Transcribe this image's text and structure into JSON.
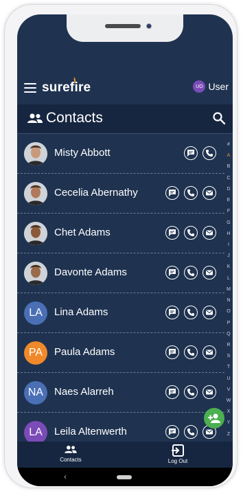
{
  "app": {
    "logo_text": "surefire",
    "user_initials": "UO",
    "user_label": "User",
    "colors": {
      "background": "#1f3350",
      "header": "#162640",
      "fab": "#4caf50",
      "user_avatar": "#7b4bb7"
    }
  },
  "header": {
    "title": "Contacts",
    "icon": "contacts-icon",
    "search_icon": "search-icon"
  },
  "contacts": [
    {
      "name": "Misty Abbott",
      "initials": "",
      "photo": true,
      "actions": [
        "message",
        "call"
      ]
    },
    {
      "name": "Cecelia Abernathy",
      "initials": "",
      "photo": true,
      "actions": [
        "message",
        "call",
        "email"
      ]
    },
    {
      "name": "Chet Adams",
      "initials": "",
      "photo": true,
      "actions": [
        "message",
        "call",
        "email"
      ]
    },
    {
      "name": "Davonte Adams",
      "initials": "",
      "photo": true,
      "actions": [
        "message",
        "call",
        "email"
      ]
    },
    {
      "name": "Lina Adams",
      "initials": "LA",
      "photo": false,
      "color": "#4a6fb5",
      "actions": [
        "message",
        "call",
        "email"
      ]
    },
    {
      "name": "Paula Adams",
      "initials": "PA",
      "photo": false,
      "color": "#f0892a",
      "actions": [
        "message",
        "call",
        "email"
      ]
    },
    {
      "name": "Naes Alarreh",
      "initials": "NA",
      "photo": false,
      "color": "#4a6fb5",
      "actions": [
        "message",
        "call",
        "email"
      ]
    },
    {
      "name": "Leila Altenwerth",
      "initials": "LA",
      "photo": false,
      "color": "#7b4bb7",
      "actions": [
        "message",
        "call",
        "email"
      ]
    }
  ],
  "alphabet": [
    "#",
    "A",
    "B",
    "C",
    "D",
    "E",
    "F",
    "G",
    "H",
    "I",
    "J",
    "K",
    "L",
    "M",
    "N",
    "O",
    "P",
    "Q",
    "R",
    "S",
    "T",
    "U",
    "V",
    "W",
    "X",
    "Y",
    "Z"
  ],
  "bottom_nav": [
    {
      "label": "Contacts",
      "icon": "contacts-icon"
    },
    {
      "label": "Log Out",
      "icon": "logout-icon"
    }
  ],
  "fab": {
    "icon": "add-contact-icon"
  }
}
